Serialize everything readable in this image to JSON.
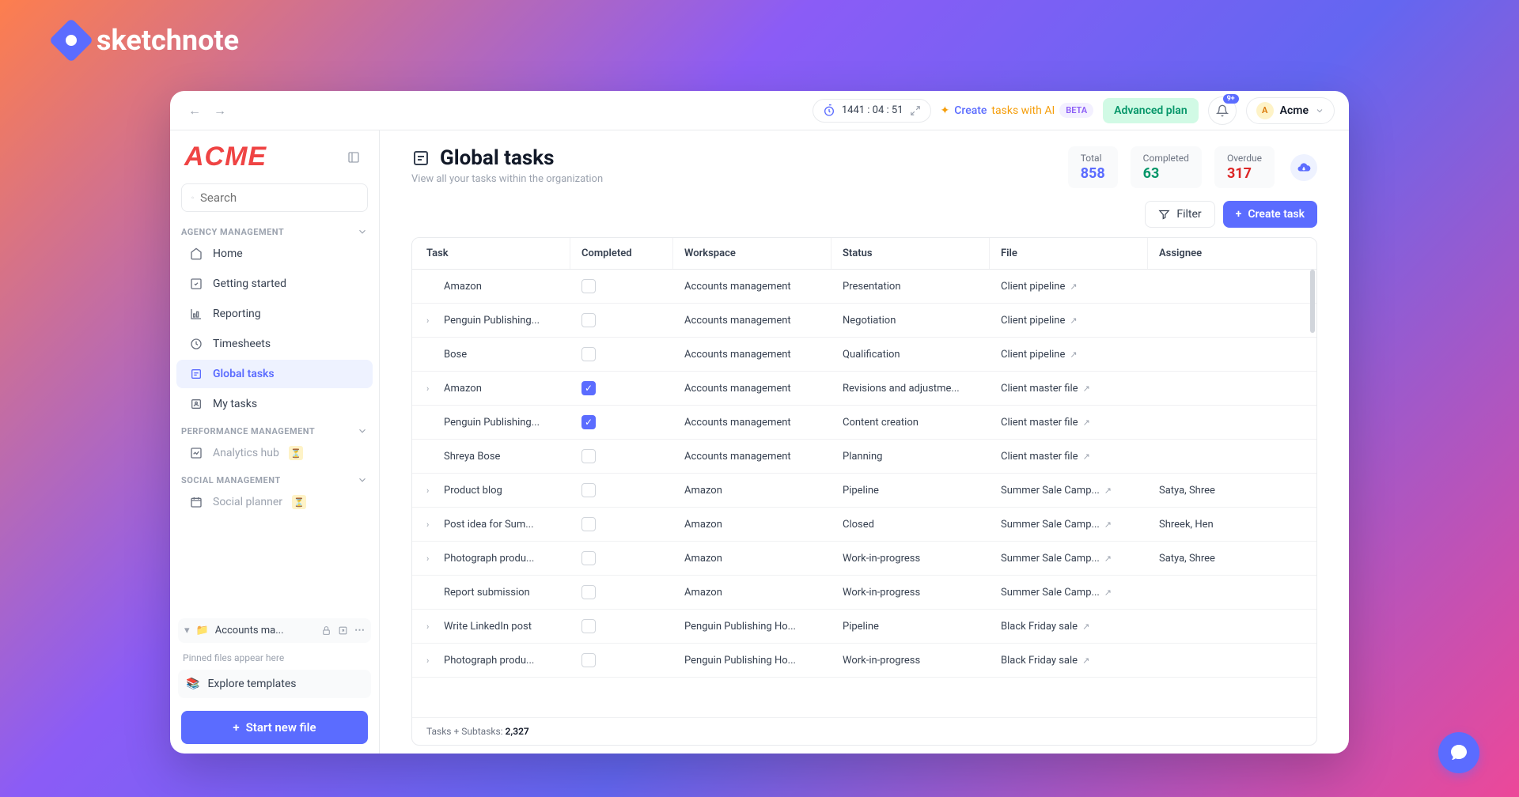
{
  "brand": "sketchnote",
  "topbar": {
    "timer": "1441 : 04 : 51",
    "ai_label": "Create tasks with AI",
    "ai_create": "Create",
    "ai_tasks": "tasks with AI",
    "beta": "BETA",
    "plan": "Advanced plan",
    "bell_badge": "9+",
    "org_initial": "A",
    "org_name": "Acme"
  },
  "sidebar": {
    "logo": "ACME",
    "search_placeholder": "Search",
    "sections": {
      "agency": "AGENCY MANAGEMENT",
      "performance": "PERFORMANCE MANAGEMENT",
      "social": "SOCIAL MANAGEMENT"
    },
    "items": {
      "home": "Home",
      "getting_started": "Getting started",
      "reporting": "Reporting",
      "timesheets": "Timesheets",
      "global_tasks": "Global tasks",
      "my_tasks": "My tasks",
      "analytics": "Analytics hub",
      "social_planner": "Social planner"
    },
    "workspace": "Accounts ma...",
    "pinned": "Pinned files appear here",
    "templates": "Explore templates",
    "new_file": "Start new file"
  },
  "header": {
    "title": "Global tasks",
    "subtitle": "View all your tasks within the organization",
    "stats": {
      "total_label": "Total",
      "total": "858",
      "completed_label": "Completed",
      "completed": "63",
      "overdue_label": "Overdue",
      "overdue": "317"
    }
  },
  "toolbar": {
    "filter": "Filter",
    "create": "Create task"
  },
  "table": {
    "headers": {
      "task": "Task",
      "completed": "Completed",
      "workspace": "Workspace",
      "status": "Status",
      "file": "File",
      "assignee": "Assignee"
    },
    "rows": [
      {
        "expand": false,
        "task": "Amazon",
        "completed": false,
        "workspace": "Accounts management",
        "status": "Presentation",
        "file": "Client pipeline",
        "assignee": ""
      },
      {
        "expand": true,
        "task": "Penguin Publishing...",
        "completed": false,
        "workspace": "Accounts management",
        "status": "Negotiation",
        "file": "Client pipeline",
        "assignee": ""
      },
      {
        "expand": false,
        "task": "Bose",
        "completed": false,
        "workspace": "Accounts management",
        "status": "Qualification",
        "file": "Client pipeline",
        "assignee": ""
      },
      {
        "expand": true,
        "task": "Amazon",
        "completed": true,
        "workspace": "Accounts management",
        "status": "Revisions and adjustme...",
        "file": "Client master file",
        "assignee": ""
      },
      {
        "expand": false,
        "task": "Penguin Publishing...",
        "completed": true,
        "workspace": "Accounts management",
        "status": "Content creation",
        "file": "Client master file",
        "assignee": ""
      },
      {
        "expand": false,
        "task": "Shreya Bose",
        "completed": false,
        "workspace": "Accounts management",
        "status": "Planning",
        "file": "Client master file",
        "assignee": ""
      },
      {
        "expand": true,
        "task": "Product blog",
        "completed": false,
        "workspace": "Amazon",
        "status": "Pipeline",
        "file": "Summer Sale Camp...",
        "assignee": "Satya, Shree"
      },
      {
        "expand": true,
        "task": "Post idea for Sum...",
        "completed": false,
        "workspace": "Amazon",
        "status": "Closed",
        "file": "Summer Sale Camp...",
        "assignee": "Shreek, Hen"
      },
      {
        "expand": true,
        "task": "Photograph produ...",
        "completed": false,
        "workspace": "Amazon",
        "status": "Work-in-progress",
        "file": "Summer Sale Camp...",
        "assignee": "Satya, Shree"
      },
      {
        "expand": false,
        "task": "Report submission",
        "completed": false,
        "workspace": "Amazon",
        "status": "Work-in-progress",
        "file": "Summer Sale Camp...",
        "assignee": ""
      },
      {
        "expand": true,
        "task": "Write LinkedIn post",
        "completed": false,
        "workspace": "Penguin Publishing Ho...",
        "status": "Pipeline",
        "file": "Black Friday sale",
        "assignee": ""
      },
      {
        "expand": true,
        "task": "Photograph produ...",
        "completed": false,
        "workspace": "Penguin Publishing Ho...",
        "status": "Work-in-progress",
        "file": "Black Friday sale",
        "assignee": ""
      }
    ],
    "footer_label": "Tasks + Subtasks:",
    "footer_value": "2,327"
  }
}
